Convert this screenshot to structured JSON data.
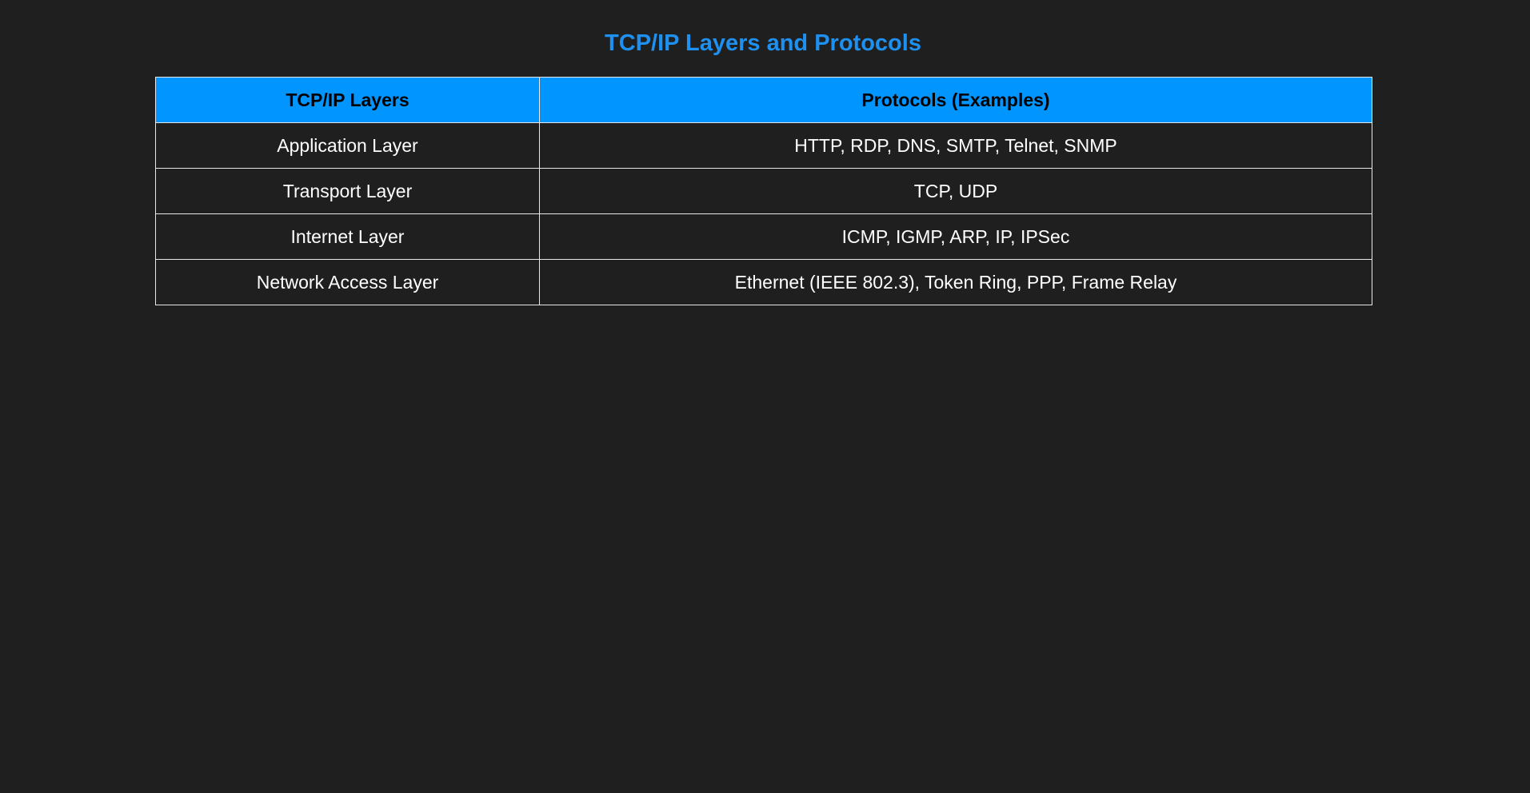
{
  "page": {
    "title": "TCP/IP Layers and Protocols"
  },
  "table": {
    "headers": [
      "TCP/IP Layers",
      "Protocols (Examples)"
    ],
    "rows": [
      [
        "Application Layer",
        "HTTP, RDP, DNS, SMTP, Telnet, SNMP"
      ],
      [
        "Transport Layer",
        "TCP, UDP"
      ],
      [
        "Internet Layer",
        "ICMP, IGMP, ARP, IP, IPSec"
      ],
      [
        "Network Access Layer",
        "Ethernet (IEEE 802.3), Token Ring, PPP, Frame Relay"
      ]
    ]
  },
  "colors": {
    "background": "#1f1f1f",
    "title": "#1e90f0",
    "header_background": "#0095ff",
    "border": "#e8e8e8"
  }
}
